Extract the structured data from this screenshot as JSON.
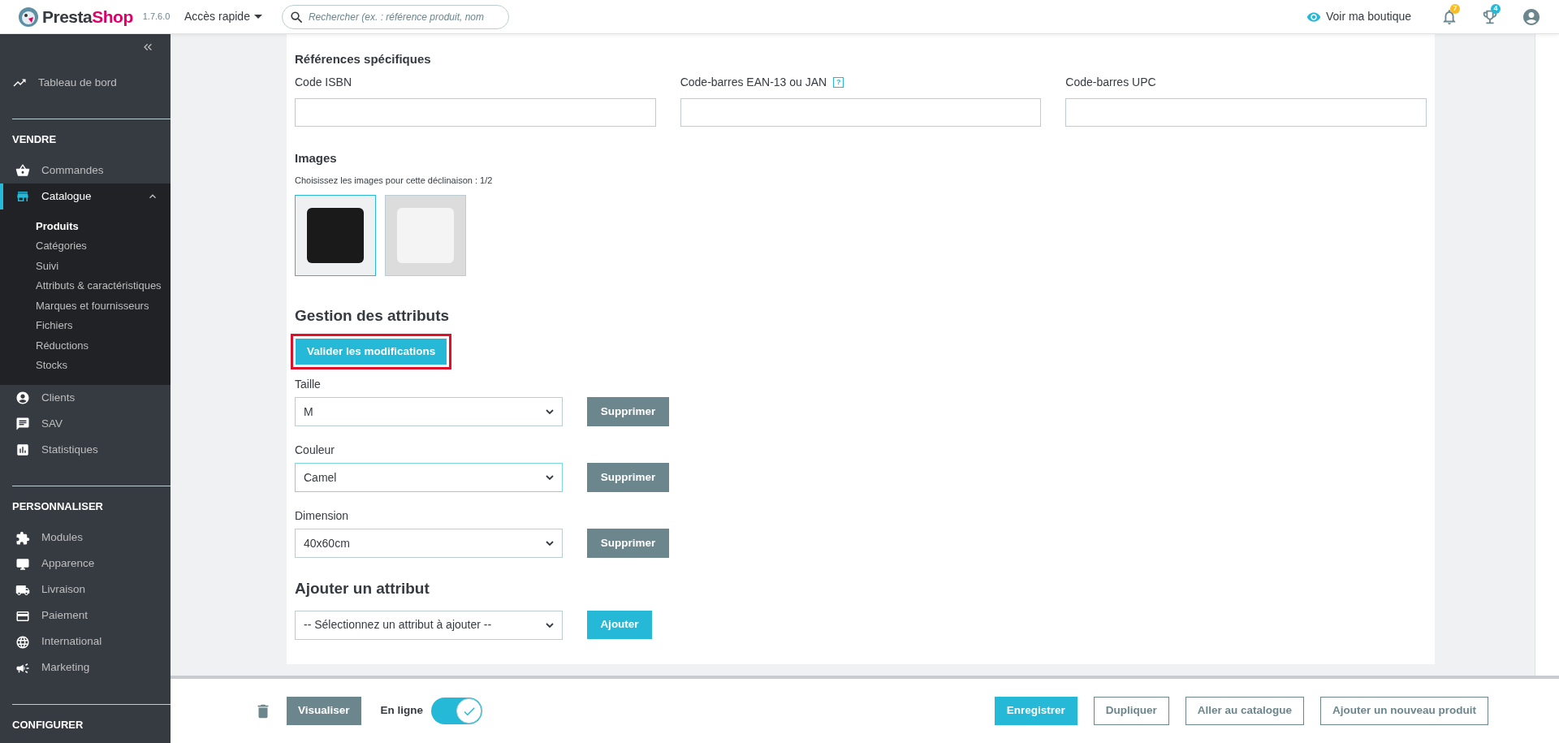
{
  "header": {
    "logo": {
      "first": "Presta",
      "second": "Shop"
    },
    "version": "1.7.6.0",
    "quick_access": "Accès rapide",
    "search": {
      "placeholder": "Rechercher (ex. : référence produit, nom"
    },
    "view_shop": "Voir ma boutique",
    "notifications_badge": "7",
    "trophy_badge": "4"
  },
  "sidebar": {
    "dashboard": {
      "label": "Tableau de bord",
      "selected": false
    },
    "sections": [
      {
        "title": "VENDRE",
        "items": [
          {
            "label": "Commandes",
            "selected": false,
            "expanded": false
          },
          {
            "label": "Catalogue",
            "selected": true,
            "expanded": true,
            "children": [
              {
                "label": "Produits",
                "selected": true
              },
              {
                "label": "Catégories",
                "selected": false
              },
              {
                "label": "Suivi",
                "selected": false
              },
              {
                "label": "Attributs & caractéristiques",
                "selected": false
              },
              {
                "label": "Marques et fournisseurs",
                "selected": false
              },
              {
                "label": "Fichiers",
                "selected": false
              },
              {
                "label": "Réductions",
                "selected": false
              },
              {
                "label": "Stocks",
                "selected": false
              }
            ]
          },
          {
            "label": "Clients",
            "selected": false,
            "expanded": false
          },
          {
            "label": "SAV",
            "selected": false,
            "expanded": false
          },
          {
            "label": "Statistiques",
            "selected": false,
            "expanded": false
          }
        ]
      },
      {
        "title": "PERSONNALISER",
        "items": [
          {
            "label": "Modules",
            "selected": false,
            "expanded": false
          },
          {
            "label": "Apparence",
            "selected": false,
            "expanded": false
          },
          {
            "label": "Livraison",
            "selected": false,
            "expanded": false
          },
          {
            "label": "Paiement",
            "selected": false,
            "expanded": false
          },
          {
            "label": "International",
            "selected": false,
            "expanded": false
          },
          {
            "label": "Marketing",
            "selected": false,
            "expanded": false
          }
        ]
      },
      {
        "title": "CONFIGURER"
      }
    ]
  },
  "references": {
    "title": "Références spécifiques",
    "fields": [
      {
        "label": "Code ISBN"
      },
      {
        "label": "Code-barres EAN-13 ou JAN",
        "help": "?"
      },
      {
        "label": "Code-barres UPC"
      }
    ]
  },
  "images": {
    "title": "Images",
    "hint": "Choisissez les images pour cette déclinaison : 1/2",
    "items": [
      {
        "selected": true,
        "color": "#1a1a1a"
      },
      {
        "selected": false,
        "color": "#f4f4f4"
      }
    ]
  },
  "attributes": {
    "title": "Gestion des attributs",
    "validate_button": "Valider les modifications",
    "highlighted": true,
    "items": [
      {
        "label": "Taille",
        "value": "M",
        "focused": false,
        "delete": "Supprimer"
      },
      {
        "label": "Couleur",
        "value": "Camel",
        "focused": true,
        "delete": "Supprimer"
      },
      {
        "label": "Dimension",
        "value": "40x60cm",
        "focused": false,
        "delete": "Supprimer"
      }
    ]
  },
  "add_attribute": {
    "title": "Ajouter un attribut",
    "select": "-- Sélectionnez un attribut à ajouter --",
    "button": "Ajouter"
  },
  "footer": {
    "preview": "Visualiser",
    "online_label": "En ligne",
    "online": {
      "on": true
    },
    "buttons": [
      {
        "label": "Enregistrer",
        "kind": "primary"
      },
      {
        "label": "Dupliquer",
        "kind": "outline"
      },
      {
        "label": "Aller au catalogue",
        "kind": "outline"
      },
      {
        "label": "Ajouter un nouveau produit",
        "kind": "outline"
      }
    ]
  }
}
